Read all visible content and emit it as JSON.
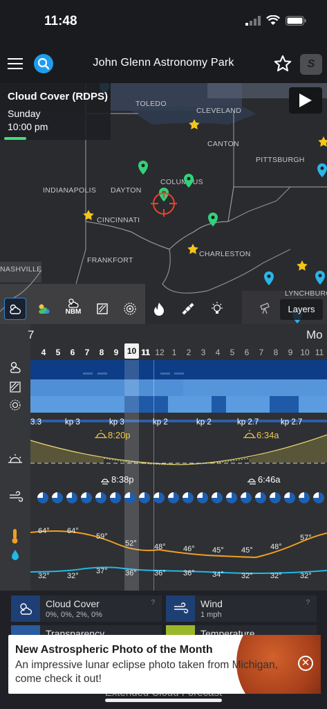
{
  "status_bar": {
    "time": "11:48"
  },
  "header": {
    "title": "John Glenn Astronomy Park",
    "pro_badge": "S"
  },
  "map": {
    "layer_card": {
      "title": "Cloud Cover (RDPS)",
      "day": "Sunday",
      "time": "10:00 pm"
    },
    "cities": [
      "TOLEDO",
      "CLEVELAND",
      "CANTON",
      "PITTSBURGH",
      "INDIANAPOLIS",
      "DAYTON",
      "COLUMBUS",
      "CINCINNATI",
      "FRANKFORT",
      "CHARLESTON",
      "LYNCHBURG",
      "NASHVILLE"
    ],
    "toolbar": {
      "nbm_label": "NBM",
      "layers_label": "Layers"
    }
  },
  "forecast": {
    "day_prev": "7",
    "day_next": "Mo",
    "hours": [
      "4",
      "5",
      "6",
      "7",
      "8",
      "9",
      "10",
      "11",
      "12",
      "1",
      "2",
      "3",
      "4",
      "5",
      "6",
      "7",
      "8",
      "9",
      "10",
      "11"
    ],
    "selected_hour": "10",
    "kp": [
      "3.3",
      "kp 3",
      "kp 3",
      "kp 2",
      "kp 2",
      "kp 2.7",
      "kp 2.7"
    ],
    "sunset": "8:20p",
    "sunrise": "6:34a",
    "moonset": "8:38p",
    "moonrise": "6:46a",
    "temps_high": [
      "64°",
      "64°",
      "59°",
      "52°",
      "48°",
      "46°",
      "45°",
      "45°",
      "48°",
      "57°"
    ],
    "temps_low": [
      "32°",
      "32°",
      "37°",
      "36°",
      "36°",
      "36°",
      "34°",
      "32°",
      "32°",
      "32°"
    ]
  },
  "legend": {
    "cloud_cover": {
      "title": "Cloud Cover",
      "sub": "0%, 0%, 2%, 0%",
      "help": "?"
    },
    "wind": {
      "title": "Wind",
      "sub": "1 mph",
      "help": "?"
    },
    "transparency": {
      "title": "Transparency"
    },
    "temperature": {
      "title": "Temperature"
    },
    "extended": "Extended Cloud Forecast"
  },
  "notification": {
    "title": "New Astrospheric Photo of the Month",
    "message": "An impressive lunar eclipse photo taken from Michigan, come check it out!"
  },
  "colors": {
    "accent_blue": "#1e9cf0",
    "pin_green": "#33d17a",
    "pin_cyan": "#2bb4e8",
    "star_gold": "#f5c518",
    "clear_sky": "#4a90d9",
    "temp_orange": "#f0a020",
    "dew_cyan": "#22b8e8"
  }
}
